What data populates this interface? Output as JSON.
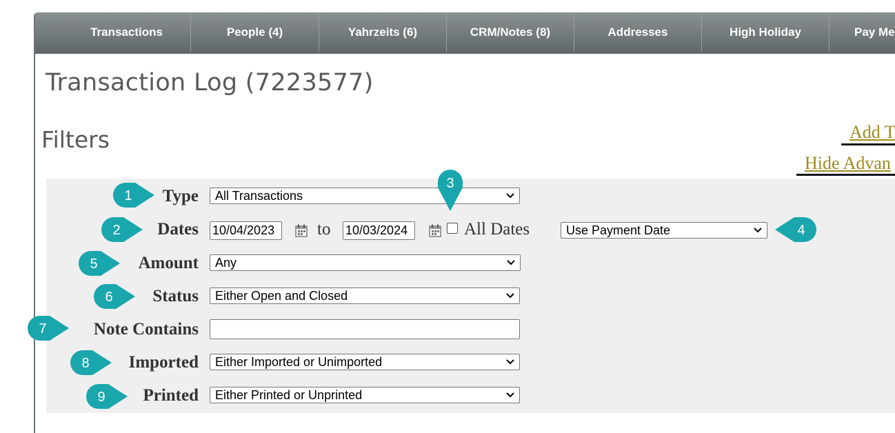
{
  "tabs": [
    {
      "label": "Transactions"
    },
    {
      "label": "People (4)"
    },
    {
      "label": "Yahrzeits (6)"
    },
    {
      "label": "CRM/Notes (8)"
    },
    {
      "label": "Addresses"
    },
    {
      "label": "High Holiday"
    },
    {
      "label": "Pay Me"
    }
  ],
  "page_title": "Transaction Log (7223577)",
  "filters_heading": "Filters",
  "links": {
    "add_transaction": "Add T",
    "hide_advanced": "Hide Advan"
  },
  "filters": {
    "type": {
      "label": "Type",
      "value": "All Transactions"
    },
    "dates": {
      "label": "Dates",
      "from": "10/04/2023",
      "to_text": "to",
      "to": "10/03/2024",
      "all_dates_label": "All Dates",
      "all_dates_checked": false,
      "date_basis": "Use Payment Date"
    },
    "amount": {
      "label": "Amount",
      "value": "Any"
    },
    "status": {
      "label": "Status",
      "value": "Either Open and Closed"
    },
    "note": {
      "label": "Note Contains",
      "value": ""
    },
    "imported": {
      "label": "Imported",
      "value": "Either Imported or Unimported"
    },
    "printed": {
      "label": "Printed",
      "value": "Either Printed or Unprinted"
    }
  },
  "callouts": [
    "1",
    "2",
    "3",
    "4",
    "5",
    "6",
    "7",
    "8",
    "9"
  ],
  "colors": {
    "callout": "#1aa6ad",
    "link": "#a08a1f",
    "panel": "#efefef",
    "tabbar": "#6e7475"
  }
}
